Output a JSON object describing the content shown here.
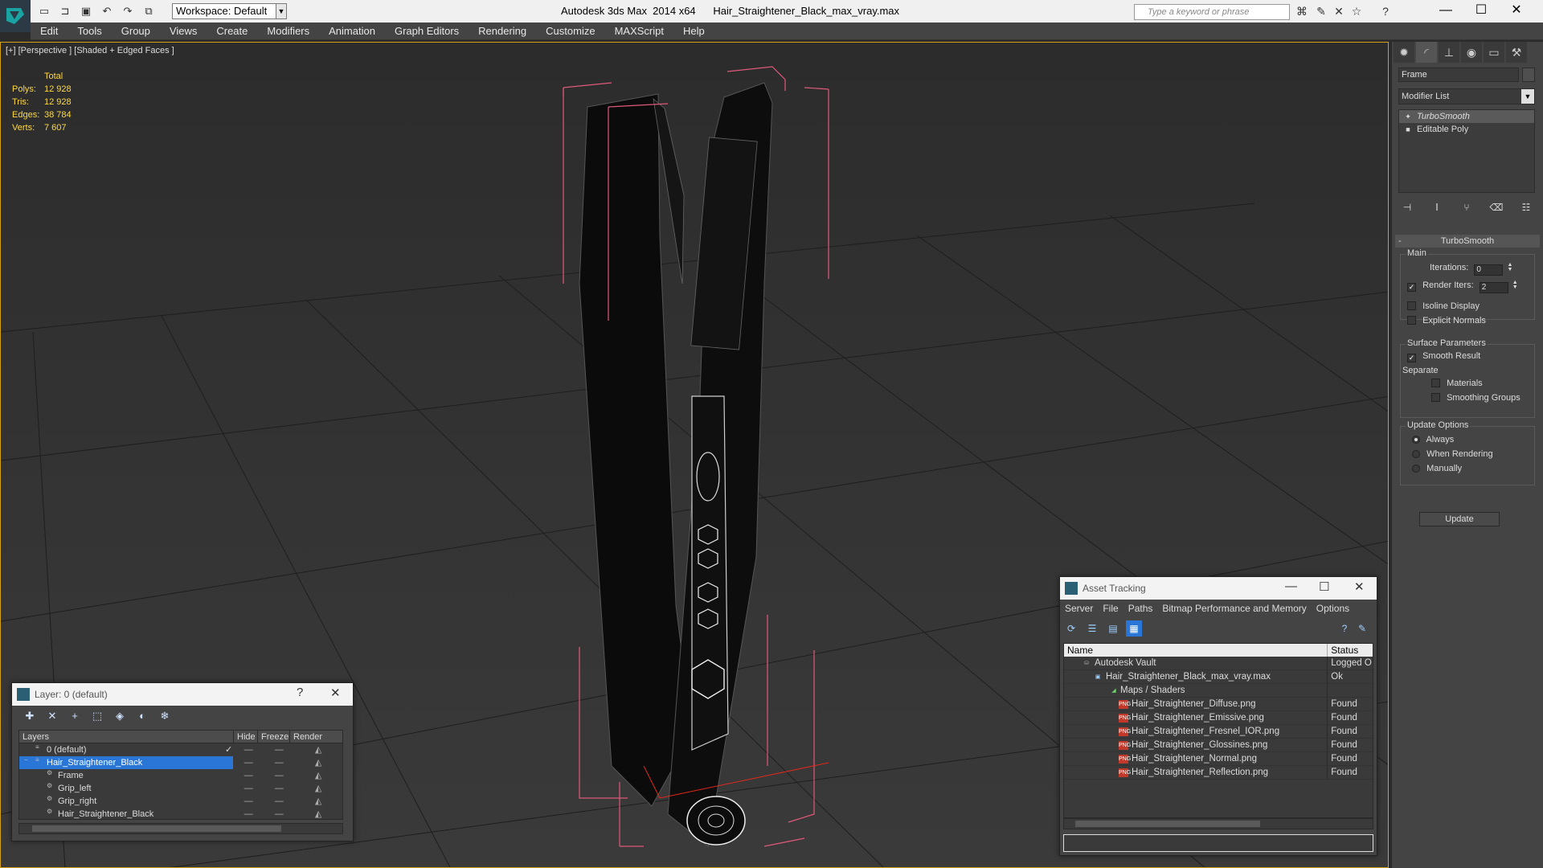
{
  "titlebar": {
    "workspace": "Workspace: Default",
    "title": "Autodesk 3ds Max  2014 x64      Hair_Straightener_Black_max_vray.max",
    "search_placeholder": "Type a keyword or phrase"
  },
  "menu": [
    "Edit",
    "Tools",
    "Group",
    "Views",
    "Create",
    "Modifiers",
    "Animation",
    "Graph Editors",
    "Rendering",
    "Customize",
    "MAXScript",
    "Help"
  ],
  "viewport": {
    "label": "[+] [Perspective ] [Shaded + Edged Faces ]",
    "stats": {
      "header": "Total",
      "rows": [
        {
          "k": "Polys:",
          "v": "12 928"
        },
        {
          "k": "Tris:",
          "v": "12 928"
        },
        {
          "k": "Edges:",
          "v": "38 784"
        },
        {
          "k": "Verts:",
          "v": "7 607"
        }
      ]
    }
  },
  "command_panel": {
    "object_name": "Frame",
    "modifier_list": "Modifier List",
    "stack": [
      "TurboSmooth",
      "Editable Poly"
    ],
    "rollout_title": "TurboSmooth",
    "main": {
      "title": "Main",
      "iterations_label": "Iterations:",
      "iterations": "0",
      "render_iters_label": "Render Iters:",
      "render_iters": "2",
      "isoline": "Isoline Display",
      "explicit_normals": "Explicit Normals"
    },
    "surface": {
      "title": "Surface Parameters",
      "smooth_result": "Smooth Result",
      "separate": "Separate",
      "materials": "Materials",
      "smoothing_groups": "Smoothing Groups"
    },
    "update": {
      "title": "Update Options",
      "always": "Always",
      "when_rendering": "When Rendering",
      "manually": "Manually",
      "button": "Update"
    }
  },
  "layer_window": {
    "title": "Layer: 0 (default)",
    "columns": [
      "Layers",
      "Hide",
      "Freeze",
      "Render"
    ],
    "rows": [
      {
        "name": "0 (default)",
        "indent": 0
      },
      {
        "name": "Hair_Straightener_Black",
        "indent": 0
      },
      {
        "name": "Frame",
        "indent": 1
      },
      {
        "name": "Grip_left",
        "indent": 1
      },
      {
        "name": "Grip_right",
        "indent": 1
      },
      {
        "name": "Hair_Straightener_Black",
        "indent": 1
      }
    ]
  },
  "asset_window": {
    "title": "Asset Tracking",
    "menu": [
      "Server",
      "File",
      "Paths",
      "Bitmap Performance and Memory",
      "Options"
    ],
    "columns": [
      "Name",
      "Status"
    ],
    "rows": [
      {
        "name": "Autodesk Vault",
        "status": "Logged O",
        "indent": 0,
        "icon": "vault"
      },
      {
        "name": "Hair_Straightener_Black_max_vray.max",
        "status": "Ok",
        "indent": 1,
        "icon": "max"
      },
      {
        "name": "Maps / Shaders",
        "status": "",
        "indent": 2,
        "icon": "maps"
      },
      {
        "name": "Hair_Straightener_Diffuse.png",
        "status": "Found",
        "indent": 3,
        "icon": "png"
      },
      {
        "name": "Hair_Straightener_Emissive.png",
        "status": "Found",
        "indent": 3,
        "icon": "png"
      },
      {
        "name": "Hair_Straightener_Fresnel_IOR.png",
        "status": "Found",
        "indent": 3,
        "icon": "png"
      },
      {
        "name": "Hair_Straightener_Glossines.png",
        "status": "Found",
        "indent": 3,
        "icon": "png"
      },
      {
        "name": "Hair_Straightener_Normal.png",
        "status": "Found",
        "indent": 3,
        "icon": "png"
      },
      {
        "name": "Hair_Straightener_Reflection.png",
        "status": "Found",
        "indent": 3,
        "icon": "png"
      }
    ]
  }
}
